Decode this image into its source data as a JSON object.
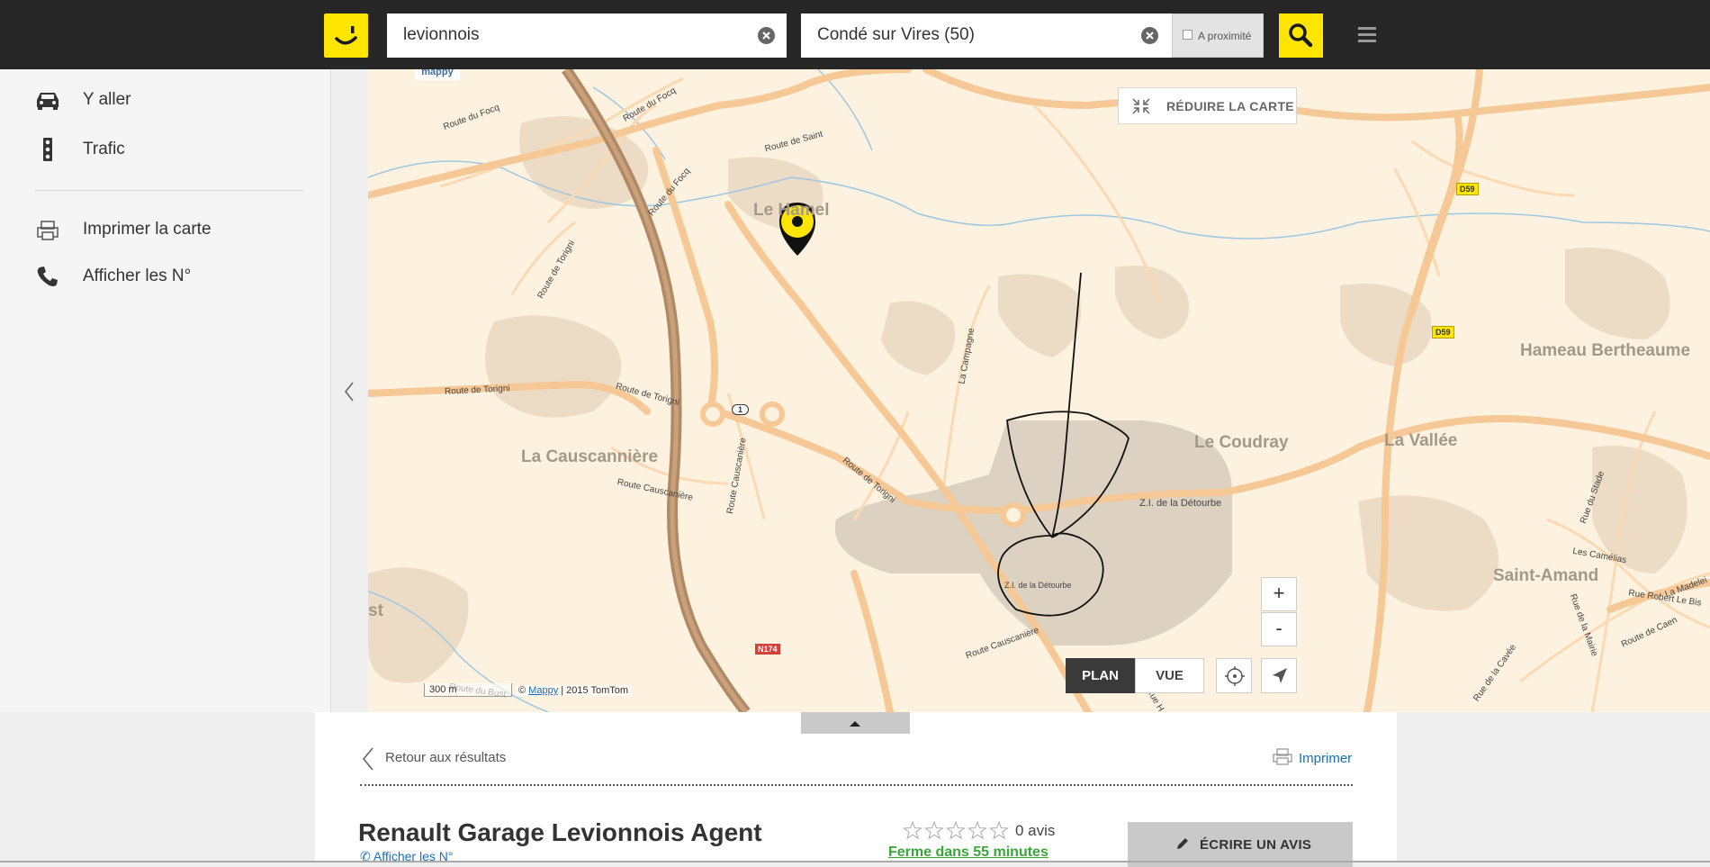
{
  "header": {
    "search_what": "levionnois",
    "search_where": "Condé sur Vires (50)",
    "proximity_label": "A proximité",
    "brand_color": "#ffe500"
  },
  "sidebar": {
    "items": [
      {
        "label": "Y aller",
        "icon": "car-icon"
      },
      {
        "label": "Trafic",
        "icon": "traffic-light-icon"
      },
      {
        "label": "Imprimer la carte",
        "icon": "printer-icon"
      },
      {
        "label": "Afficher les N°",
        "icon": "phone-icon"
      }
    ]
  },
  "map": {
    "reduce_label": "RÉDUIRE LA CARTE",
    "zoom_in": "+",
    "zoom_out": "-",
    "plan_label": "PLAN",
    "vue_label": "VUE",
    "scale_label": "300 m",
    "copyright_prefix": "©",
    "copyright_link": "Mappy",
    "copyright_suffix": "| 2015 TomTom",
    "logo_text": "mappy",
    "places": {
      "le_hamel": "Le Hamel",
      "la_causcanniere": "La Causcannière",
      "le_coudray": "Le Coudray",
      "la_vallee": "La Vallée",
      "hameau_bertheaume": "Hameau Bertheaume",
      "saint_amand": "Saint-Amand",
      "zi_detourbe": "Z.I. de la Détourbe",
      "zi_detourbe_small": "Z.I. de la Détourbe",
      "partial_st": "st"
    },
    "roads": {
      "route_focq_1": "Route du Focq",
      "route_focq_2": "Route du Focq",
      "route_focq_3": "Route du Focq",
      "route_torigni_1": "Route de Torigni",
      "route_torigni_2": "Route de Torigni",
      "route_torigni_3": "Route de Torigni",
      "route_torigni_4": "Route de Torigni",
      "route_causcaniere_1": "Route Causcanière",
      "route_causcaniere_2": "Route Causcanière",
      "route_causcaniere_3": "Route Causcanière",
      "route_campagne": "La Campagne",
      "route_saint": "Route de Saint",
      "route_bust": "Route du Bust",
      "rue_stade": "Rue du Stade",
      "les_camelias": "Les Camélias",
      "rue_robert": "Rue Robert Le Bis",
      "rue_mairie": "Rue de la Mairie",
      "rue_cavee": "Rue de la Cavée",
      "route_caen": "Route de Caen",
      "la_madeleine": "La Madelei",
      "rue_hd": "Rue H"
    },
    "badges": {
      "d59_top": "D59",
      "d59_mid": "D59",
      "n174": "N174",
      "exit": "1"
    }
  },
  "panel": {
    "back_label": "Retour aux résultats",
    "print_label": "Imprimer",
    "business_name": "Renault Garage Levionnois Agent",
    "show_numbers": "Afficher les N°",
    "reviews_count": "0 avis",
    "rating": 0,
    "rating_max": 5,
    "closing": "Ferme dans 55 minutes",
    "write_review": "ÉCRIRE UN AVIS"
  }
}
